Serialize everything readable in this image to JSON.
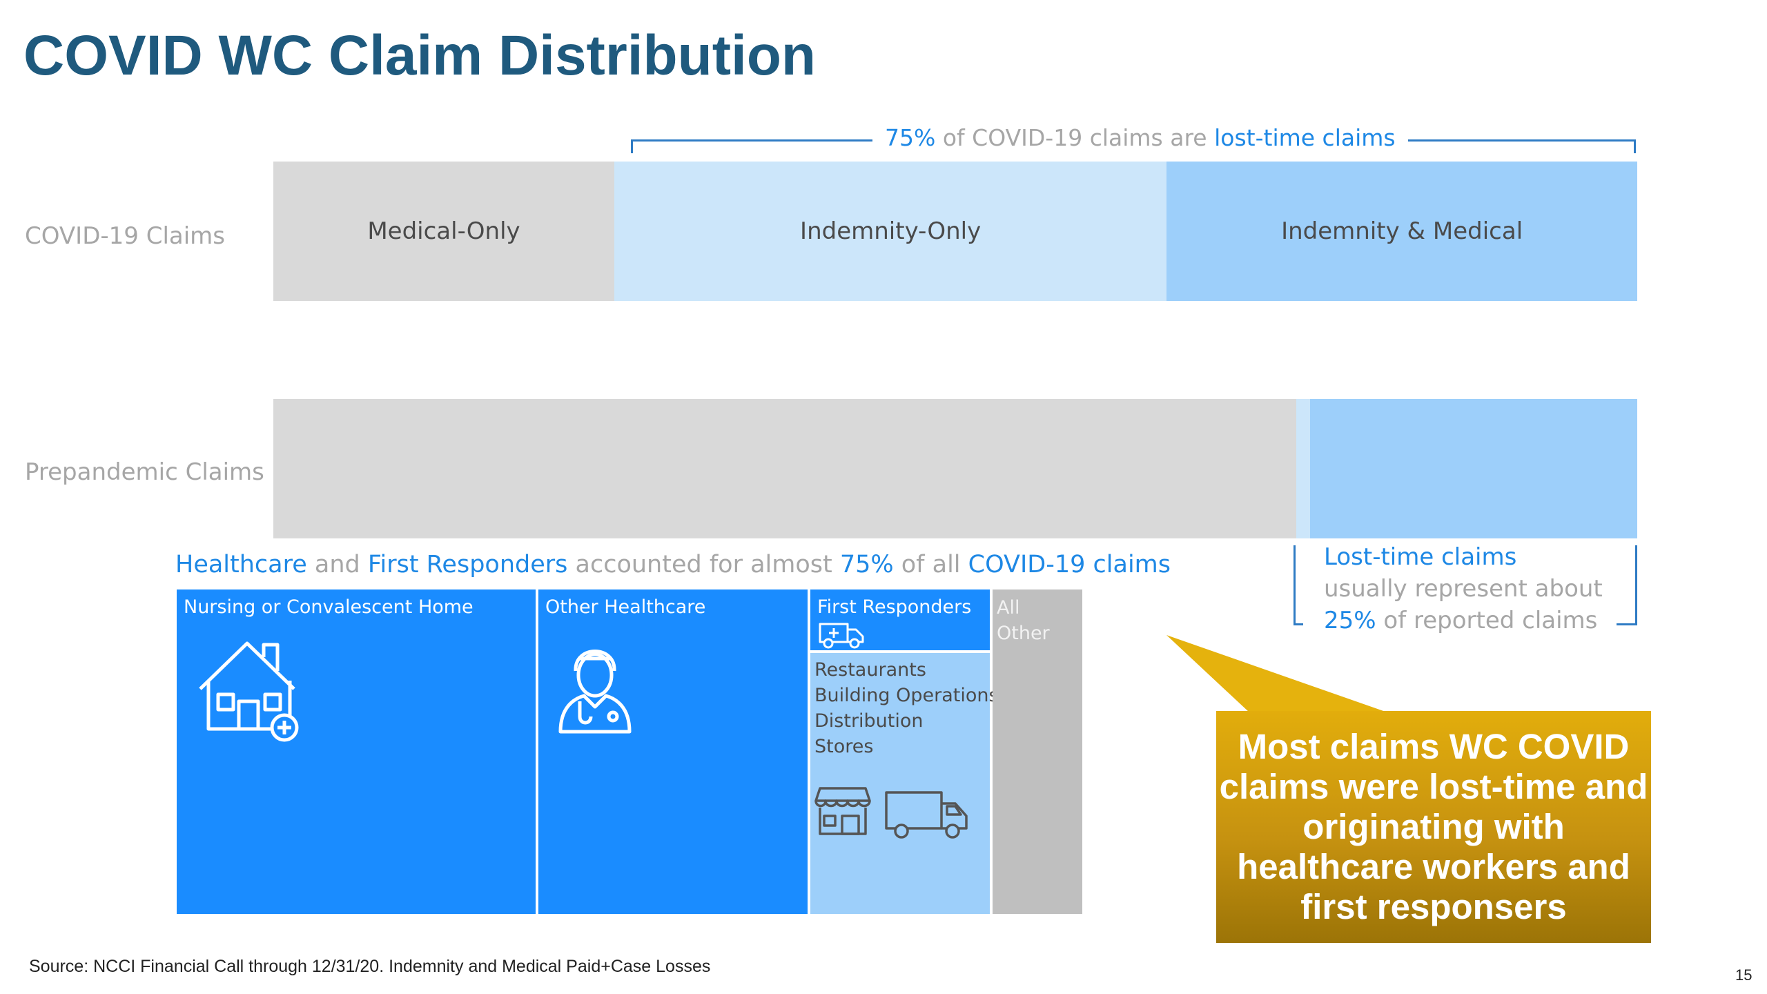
{
  "title": "COVID WC Claim Distribution",
  "chart_data": [
    {
      "type": "bar",
      "orientation": "horizontal-stacked-100",
      "categories": [
        "COVID-19 Claims",
        "Prepandemic Claims"
      ],
      "series": [
        {
          "name": "Medical-Only",
          "values": [
            25,
            75
          ],
          "color": "#d9d9d9"
        },
        {
          "name": "Indemnity-Only",
          "values": [
            40.5,
            1
          ],
          "color": "#cce6fa"
        },
        {
          "name": "Indemnity & Medical",
          "values": [
            34.5,
            24
          ],
          "color": "#9dcffa"
        }
      ],
      "bracket_top": {
        "pct": "75%",
        "middle": "of COVID-19 claims are",
        "tail": "lost-time claims"
      },
      "bracket_bottom": {
        "line1": "Lost-time claims",
        "line2": "usually represent about",
        "pct": "25%",
        "line3": "of reported claims"
      }
    },
    {
      "type": "treemap",
      "heading": {
        "part1": "Healthcare",
        "part2": " and ",
        "part3": "First Responders",
        "part4": " accounted for almost ",
        "part5": "75%",
        "part6": " of all ",
        "part7": "COVID-19 claims"
      },
      "cells": [
        {
          "label": "Nursing or Convalescent Home",
          "share": 40,
          "color": "#1a8cff",
          "icon": "house-medical-icon"
        },
        {
          "label": "Other Healthcare",
          "share": 30,
          "color": "#1a8cff",
          "icon": "nurse-icon"
        },
        {
          "label": "First Responders",
          "share": 4.5,
          "color": "#1a8cff",
          "icon": "ambulance-icon"
        },
        {
          "label": "Restaurants\nBuilding Operations\nDistribution\nStores",
          "share": 15.5,
          "color": "#9dcffa",
          "icons": [
            "storefront-icon",
            "delivery-truck-icon"
          ]
        },
        {
          "label": "All\nOther",
          "share": 10,
          "color": "#bfbfbf"
        }
      ]
    }
  ],
  "callout": "Most claims WC COVID claims were lost-time and originating with healthcare workers and first responsers",
  "source": "Source: NCCI Financial Call through 12/31/20.  Indemnity and Medical Paid+Case Losses",
  "page_number": "15"
}
